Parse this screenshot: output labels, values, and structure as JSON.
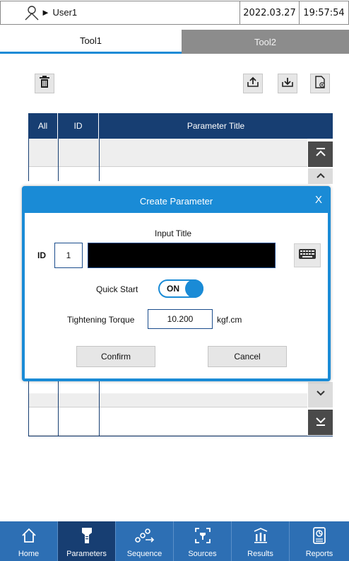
{
  "status": {
    "user": "► User1",
    "date": "2022.03.27",
    "time": "19:57:54"
  },
  "tabs": [
    {
      "label": "Tool1"
    },
    {
      "label": "Tool2"
    }
  ],
  "table": {
    "headers": [
      "All",
      "ID",
      "Parameter Title"
    ]
  },
  "dialog": {
    "title": "Create Parameter",
    "close": "X",
    "input_title_label": "Input Title",
    "id_label": "ID",
    "id_value": "1",
    "title_value": "",
    "quick_start_label": "Quick Start",
    "quick_start_state": "ON",
    "torque_label": "Tightening Torque",
    "torque_value": "10.200",
    "torque_unit": "kgf.cm",
    "confirm": "Confirm",
    "cancel": "Cancel"
  },
  "nav": [
    {
      "label": "Home",
      "icon": "home-icon"
    },
    {
      "label": "Parameters",
      "icon": "wrench-icon"
    },
    {
      "label": "Sequence",
      "icon": "sequence-icon"
    },
    {
      "label": "Sources",
      "icon": "sources-icon"
    },
    {
      "label": "Results",
      "icon": "results-icon"
    },
    {
      "label": "Reports",
      "icon": "reports-icon"
    }
  ],
  "colors": {
    "accent": "#1a8bd6",
    "header_navy": "#173e72",
    "nav_blue": "#2d6fb4"
  }
}
